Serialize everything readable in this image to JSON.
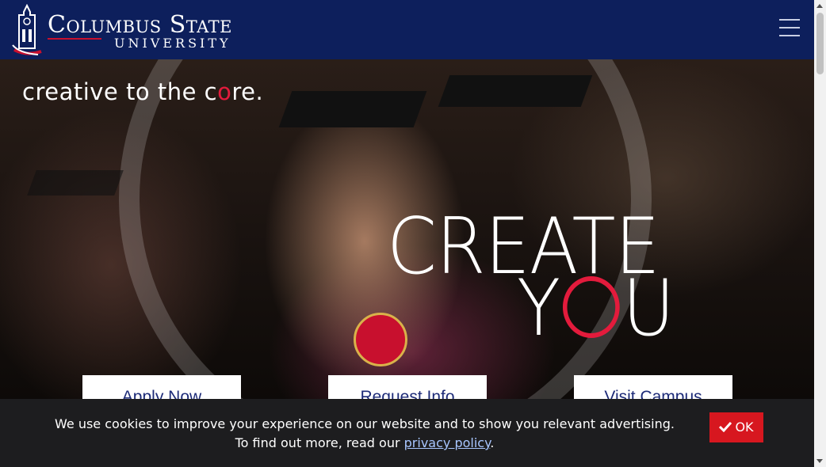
{
  "header": {
    "logo_name": "Columbus State",
    "logo_subtitle": "UNIVERSITY",
    "menu_icon": "hamburger-menu-icon"
  },
  "hero": {
    "tagline_before": "creative to the c",
    "tagline_accent": "o",
    "tagline_after": "re.",
    "headline_line1": "CREATE",
    "headline_line2_start": "Y",
    "headline_line2_end": "U",
    "accent_color": "#e31b3c"
  },
  "cta": {
    "apply": "Apply Now",
    "request": "Request Info",
    "visit": "Visit Campus"
  },
  "cookie": {
    "message": "We use cookies to improve your experience on our website and to show you relevant advertising. To find out more, read our ",
    "link_text": "privacy policy",
    "period": ".",
    "ok_label": "OK",
    "ok_icon": "check-icon"
  },
  "colors": {
    "header_bg": "#0d1f5c",
    "cookie_bg": "#1d1d1f",
    "ok_bg": "#d7171f"
  }
}
